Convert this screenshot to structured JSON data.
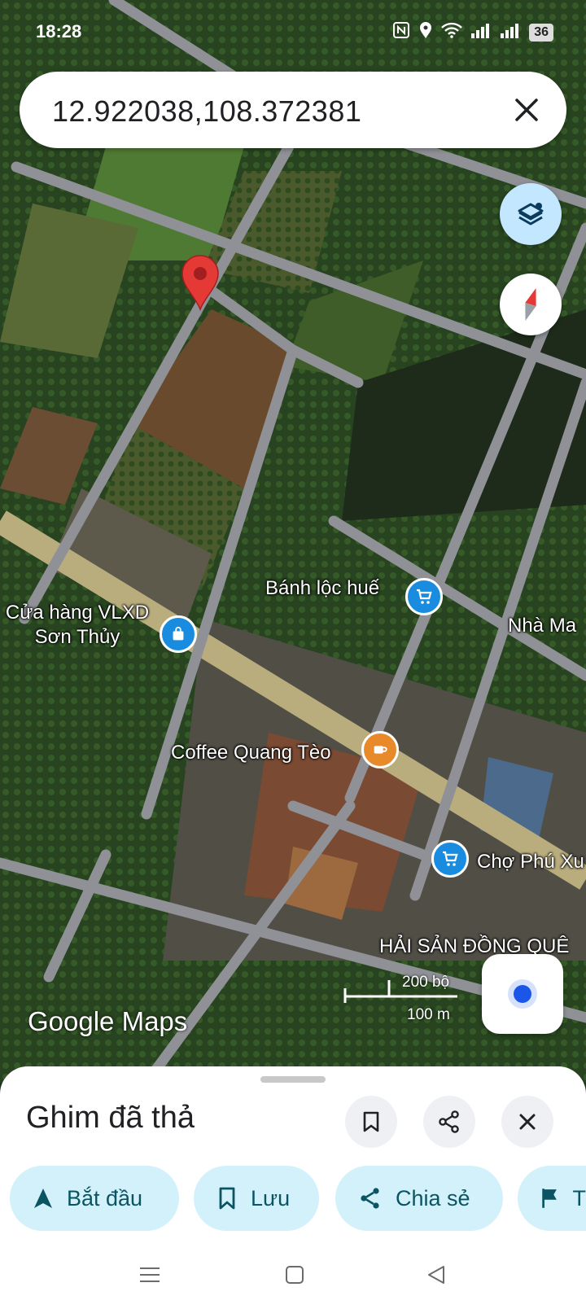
{
  "status_bar": {
    "time": "18:28",
    "battery": "36"
  },
  "search": {
    "value": "12.922038,108.372381"
  },
  "map": {
    "pois": [
      {
        "label": "Bánh lộc huế",
        "icon": "shopping-cart-icon",
        "color": "#1a8ce0"
      },
      {
        "label": "Cửa hàng VLXD\nSơn Thủy",
        "icon": "shopping-bag-icon",
        "color": "#1a8ce0"
      },
      {
        "label": "Nhà Ma",
        "icon": "",
        "color": ""
      },
      {
        "label": "Coffee Quang Tèo",
        "icon": "coffee-cup-icon",
        "color": "#e98a2a"
      },
      {
        "label": "Chợ Phú Xu",
        "icon": "shopping-cart-icon",
        "color": "#1a8ce0"
      },
      {
        "label": "HẢI SẢN ĐỒNG QUÊ",
        "icon": "",
        "color": ""
      }
    ],
    "scale": {
      "imperial": "200 bộ",
      "metric": "100 m"
    },
    "logo": "Google Maps",
    "pin_color": "#e53935"
  },
  "sheet": {
    "title": "Ghim đã thả",
    "chips": [
      {
        "label": "Bắt đầu",
        "icon": "navigation-arrow-icon"
      },
      {
        "label": "Lưu",
        "icon": "bookmark-icon"
      },
      {
        "label": "Chia sẻ",
        "icon": "share-icon"
      },
      {
        "label": "T",
        "icon": "flag-icon"
      }
    ]
  },
  "colors": {
    "accent": "#c2e7ff",
    "chip_bg": "#d3f1fb",
    "chip_text": "#0b5563",
    "location_dot": "#1a57e8"
  }
}
